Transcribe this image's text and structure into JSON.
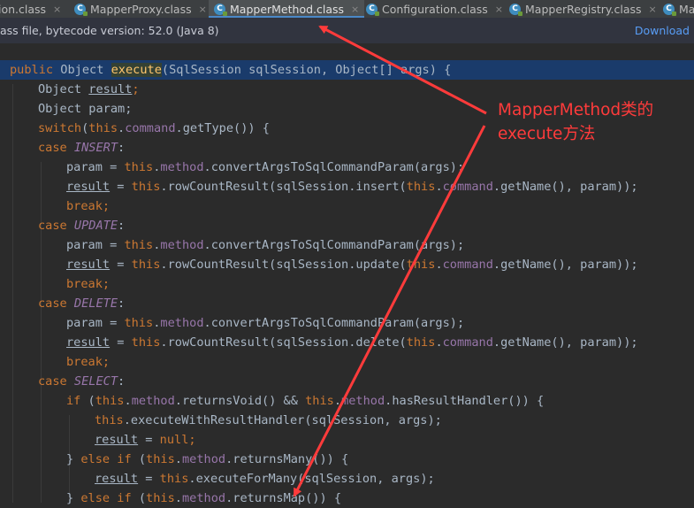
{
  "tabs": [
    {
      "label": "ion.class",
      "active": false
    },
    {
      "label": "MapperProxy.class",
      "active": false
    },
    {
      "label": "MapperMethod.class",
      "active": true
    },
    {
      "label": "Configuration.class",
      "active": false
    },
    {
      "label": "MapperRegistry.class",
      "active": false
    },
    {
      "label": "Ma",
      "active": false
    }
  ],
  "tab_close_glyph": "×",
  "banner": {
    "text": "ass file, bytecode version: 52.0 (Java 8)",
    "download_label": "Download"
  },
  "code": {
    "l1": {
      "p0": "public",
      "p1": " ",
      "p2": "Object",
      "p3": " ",
      "p4": "execute",
      "p5": "(SqlSession sqlSession, Object[] args) {"
    },
    "l2": {
      "p0": "Object ",
      "p1": "result",
      "p2": ";"
    },
    "l3": {
      "p0": "Object param;"
    },
    "l4": {
      "p0": "switch",
      "p1": "(",
      "p2": "this",
      "p3": ".",
      "p4": "command",
      "p5": ".getType()) {"
    },
    "l5": {
      "p0": "case ",
      "p1": "INSERT",
      "p2": ":"
    },
    "l6": {
      "p0": "param = ",
      "p1": "this",
      "p2": ".",
      "p3": "method",
      "p4": ".convertArgsToSqlCommandParam(args);"
    },
    "l7": {
      "p0": "result",
      "p1": " = ",
      "p2": "this",
      "p3": ".rowCountResult(sqlSession.insert(",
      "p4": "this",
      "p5": ".",
      "p6": "command",
      "p7": ".getName(), param));"
    },
    "l8": {
      "p0": "break",
      "p1": ";"
    },
    "l9": {
      "p0": "case ",
      "p1": "UPDATE",
      "p2": ":"
    },
    "l10": {
      "p0": "param = ",
      "p1": "this",
      "p2": ".",
      "p3": "method",
      "p4": ".convertArgsToSqlCommandParam(args);"
    },
    "l11": {
      "p0": "result",
      "p1": " = ",
      "p2": "this",
      "p3": ".rowCountResult(sqlSession.update(",
      "p4": "this",
      "p5": ".",
      "p6": "command",
      "p7": ".getName(), param));"
    },
    "l12": {
      "p0": "break",
      "p1": ";"
    },
    "l13": {
      "p0": "case ",
      "p1": "DELETE",
      "p2": ":"
    },
    "l14": {
      "p0": "param = ",
      "p1": "this",
      "p2": ".",
      "p3": "method",
      "p4": ".convertArgsToSqlCommandParam(args);"
    },
    "l15": {
      "p0": "result",
      "p1": " = ",
      "p2": "this",
      "p3": ".rowCountResult(sqlSession.delete(",
      "p4": "this",
      "p5": ".",
      "p6": "command",
      "p7": ".getName(), param));"
    },
    "l16": {
      "p0": "break",
      "p1": ";"
    },
    "l17": {
      "p0": "case ",
      "p1": "SELECT",
      "p2": ":"
    },
    "l18": {
      "p0": "if",
      "p1": " (",
      "p2": "this",
      "p3": ".",
      "p4": "method",
      "p5": ".returnsVoid() && ",
      "p6": "this",
      "p7": ".",
      "p8": "method",
      "p9": ".hasResultHandler()) {"
    },
    "l19": {
      "p0": "this",
      "p1": ".executeWithResultHandler(sqlSession, args);"
    },
    "l20": {
      "p0": "result",
      "p1": " = ",
      "p2": "null",
      "p3": ";"
    },
    "l21": {
      "p0": "} ",
      "p1": "else if",
      "p2": " (",
      "p3": "this",
      "p4": ".",
      "p5": "method",
      "p6": ".returnsMany()) {"
    },
    "l22": {
      "p0": "result",
      "p1": " = ",
      "p2": "this",
      "p3": ".executeForMany(sqlSession, args);"
    },
    "l23": {
      "p0": "} ",
      "p1": "else if",
      "p2": " (",
      "p3": "this",
      "p4": ".",
      "p5": "method",
      "p6": ".returnsMap()) {"
    }
  },
  "annotation": {
    "line1": "MapperMethod类的",
    "line2": "execute方法",
    "color": "#ff3b3b"
  },
  "colors": {
    "keyword": "#cc7832",
    "method_decl": "#ffc66d",
    "field": "#9876aa",
    "text": "#a9b7c6",
    "background": "#2b2b2b",
    "highlight_line": "#1a3b6b",
    "link": "#589df6"
  }
}
